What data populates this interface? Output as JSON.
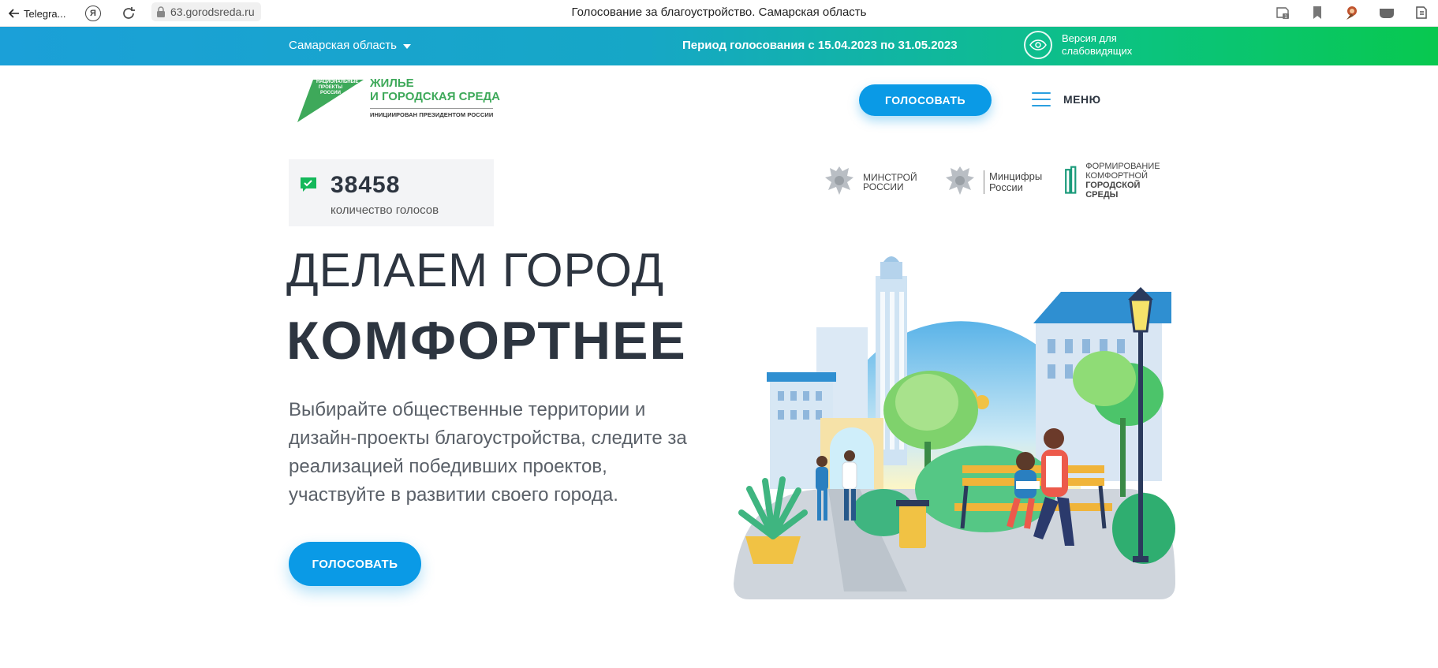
{
  "browser": {
    "back_label": "Telegra...",
    "ya_glyph": "Я",
    "url": "63.gorodsreda.ru",
    "tab_title": "Голосование за благоустройство. Самарская область",
    "badge_count": "1"
  },
  "topbar": {
    "region": "Самарская область",
    "period": "Период голосования с 15.04.2023 по 31.05.2023",
    "vision_line1": "Версия для",
    "vision_line2": "слабовидящих"
  },
  "logo": {
    "badge_text": "НАЦИОНАЛЬНЫЕ ПРОЕКТЫ РОССИИ",
    "title_line1": "ЖИЛЬЕ",
    "title_line2": "И ГОРОДСКАЯ СРЕДА",
    "subtitle": "ИНИЦИИРОВАН ПРЕЗИДЕНТОМ РОССИИ"
  },
  "header": {
    "vote_button": "ГОЛОСОВАТЬ",
    "menu_label": "МЕНЮ"
  },
  "counter": {
    "value": "38458",
    "label": "количество голосов"
  },
  "partners": {
    "minstroy_line1": "МИНСТРОЙ",
    "minstroy_line2": "РОССИИ",
    "mintsifry_line1": "Минцифры",
    "mintsifry_line2": "России",
    "fkgs_line1": "ФОРМИРОВАНИЕ",
    "fkgs_line2": "КОМФОРТНОЙ",
    "fkgs_line3": "ГОРОДСКОЙ СРЕДЫ"
  },
  "hero": {
    "line1": "ДЕЛАЕМ ГОРОД",
    "line2": "КОМФОРТНЕЕ",
    "desc_lines": [
      "Выбирайте общественные территории и",
      "дизайн-проекты благоустройства, следите за",
      "реализацией победивших проектов,",
      "участвуйте в развитии своего города."
    ],
    "vote_button": "ГОЛОСОВАТЬ"
  },
  "colors": {
    "accent": "#0a9ae6",
    "gradient_start": "#1ba0d8",
    "gradient_end": "#08c84f",
    "logo_green": "#3ea95a",
    "text_dark": "#2d3540"
  },
  "icons": [
    "back-arrow-icon",
    "yandex-icon",
    "reload-icon",
    "lock-icon",
    "eye-icon",
    "check-icon",
    "burger-icon",
    "eagle-emblem-icon"
  ]
}
